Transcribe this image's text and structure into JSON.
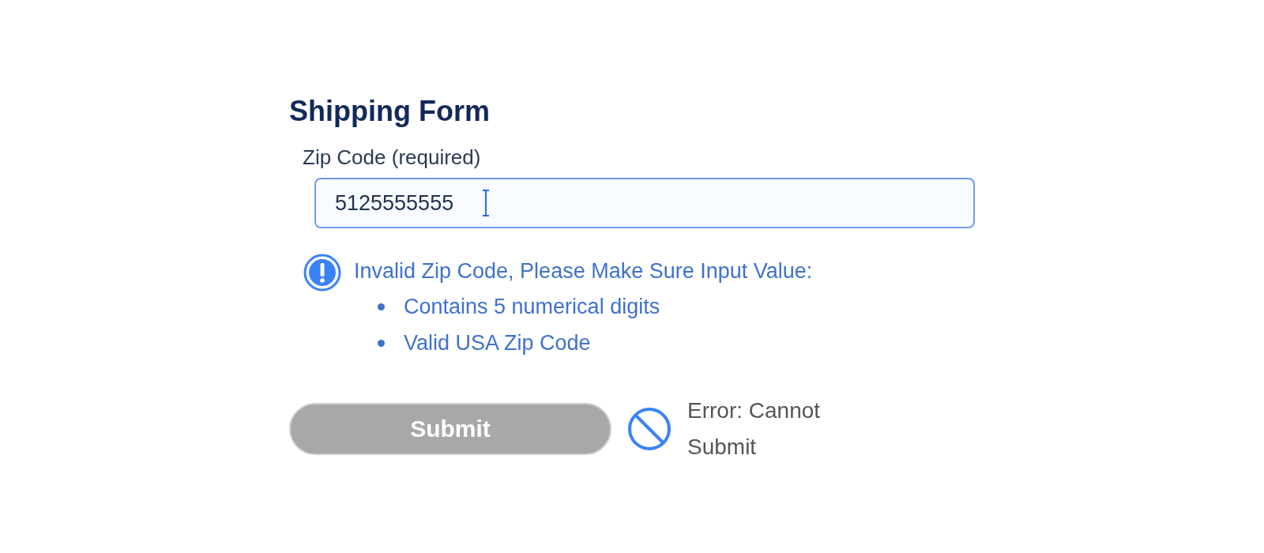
{
  "form": {
    "title": "Shipping Form",
    "zip_field": {
      "label": "Zip Code (required)",
      "value": "5125555555",
      "invalid": true
    },
    "validation": {
      "message": "Invalid Zip Code, Please Make Sure Input Value:",
      "rules": [
        "Contains 5 numerical digits",
        "Valid USA Zip Code"
      ]
    },
    "submit": {
      "label": "Submit",
      "disabled": true
    },
    "submit_error": "Error: Cannot Submit"
  }
}
